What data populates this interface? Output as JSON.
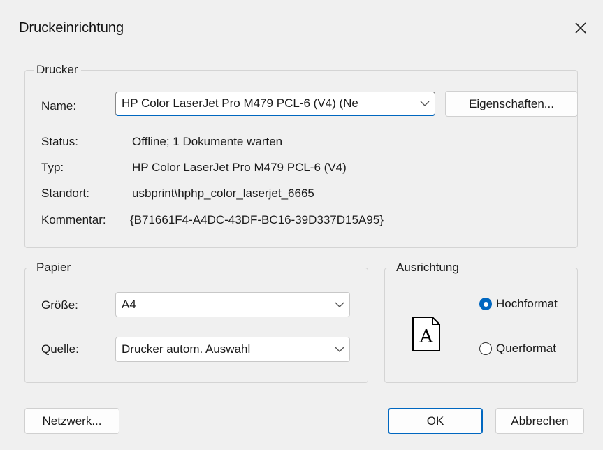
{
  "window": {
    "title": "Druckeinrichtung"
  },
  "printer": {
    "group_label": "Drucker",
    "name_label": "Name:",
    "name_value": "HP Color LaserJet Pro M479 PCL-6 (V4) (Ne",
    "properties_button": "Eigenschaften...",
    "status_label": "Status:",
    "status_value": "Offline; 1 Dokumente warten",
    "type_label": "Typ:",
    "type_value": "HP Color LaserJet Pro M479 PCL-6 (V4)",
    "location_label": "Standort:",
    "location_value": "usbprint\\hphp_color_laserjet_6665",
    "comment_label": "Kommentar:",
    "comment_value": "{B71661F4-A4DC-43DF-BC16-39D337D15A95}"
  },
  "paper": {
    "group_label": "Papier",
    "size_label": "Größe:",
    "size_value": "A4",
    "source_label": "Quelle:",
    "source_value": "Drucker autom. Auswahl"
  },
  "orientation": {
    "group_label": "Ausrichtung",
    "icon_letter": "A",
    "portrait_label": "Hochformat",
    "landscape_label": "Querformat",
    "selected": "portrait"
  },
  "buttons": {
    "network": "Netzwerk...",
    "ok": "OK",
    "cancel": "Abbrechen"
  },
  "colors": {
    "accent": "#0067c0"
  }
}
